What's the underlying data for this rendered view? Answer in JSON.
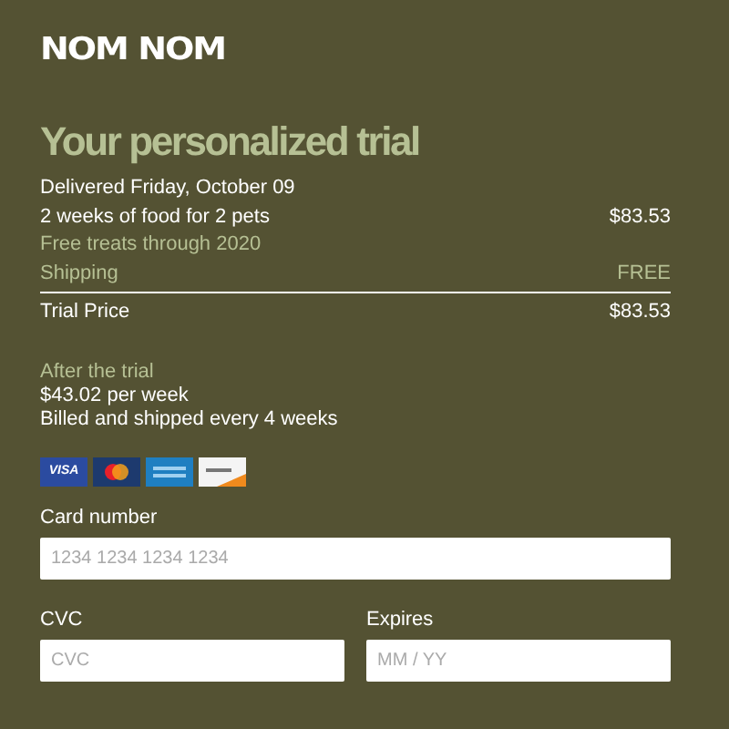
{
  "logo": "NOM NOM",
  "title": "Your personalized trial",
  "delivery": "Delivered Friday, October 09",
  "lines": [
    {
      "kind": "item",
      "label": "2 weeks of food for 2 pets",
      "amount": "$83.53"
    },
    {
      "kind": "note",
      "label": "Free treats through 2020"
    },
    {
      "kind": "muted",
      "label": "Shipping",
      "amount": "FREE"
    },
    {
      "kind": "total",
      "label": "Trial Price",
      "amount": "$83.53"
    }
  ],
  "after": {
    "heading": "After the trial",
    "price": "$43.02 per week",
    "billing": "Billed and shipped every 4 weeks"
  },
  "cards": [
    {
      "kind": "visa",
      "text": "VISA"
    },
    {
      "kind": "mastercard"
    },
    {
      "kind": "amex"
    },
    {
      "kind": "discover"
    }
  ],
  "fields": [
    {
      "label": "Card number",
      "placeholder": "1234 1234 1234 1234",
      "kind": "wide"
    },
    {
      "label": "CVC",
      "placeholder": "CVC",
      "kind": "narrow"
    },
    {
      "label": "Expires",
      "placeholder": "MM / YY",
      "kind": "narrow"
    }
  ]
}
